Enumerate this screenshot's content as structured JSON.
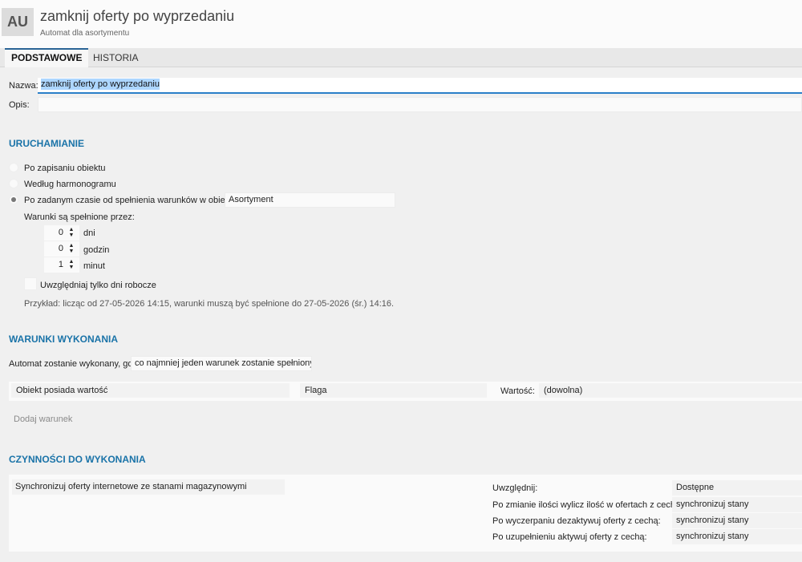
{
  "header": {
    "avatar": "AU",
    "title": "zamknij oferty po wyprzedaniu",
    "subtitle": "Automat dla asortymentu"
  },
  "tabs": [
    {
      "label": "PODSTAWOWE",
      "active": true
    },
    {
      "label": "HISTORIA",
      "active": false
    }
  ],
  "form": {
    "name_label": "Nazwa:",
    "name_value": "zamknij oferty po wyprzedaniu",
    "desc_label": "Opis:",
    "desc_value": ""
  },
  "run": {
    "section_title": "URUCHAMIANIE",
    "options": [
      {
        "label": "Po zapisaniu obiektu",
        "selected": false
      },
      {
        "label": "Według harmonogramu",
        "selected": false
      },
      {
        "label": "Po zadanym czasie od spełnienia warunków w obiekcie",
        "selected": true
      }
    ],
    "object_value": "Asortyment",
    "conditions_label": "Warunki są spełnione przez:",
    "days_value": "0",
    "days_label": "dni",
    "hours_value": "0",
    "hours_label": "godzin",
    "minutes_value": "1",
    "minutes_label": "minut",
    "workdays_label": "Uwzględniaj tylko dni robocze",
    "workdays_checked": false,
    "example": "Przykład: licząc od 27-05-2026 14:15, warunki muszą być spełnione do 27-05-2026 (śr.) 14:16."
  },
  "conditions": {
    "section_title": "WARUNKI WYKONANIA",
    "mode_label": "Automat zostanie wykonany, gdy",
    "mode_value": "co najmniej jeden warunek zostanie spełniony",
    "row": {
      "field": "Obiekt posiada wartość",
      "attribute": "Flaga",
      "value_label": "Wartość:",
      "value": "(dowolna)"
    },
    "add_label": "Dodaj warunek"
  },
  "actions": {
    "section_title": "CZYNNOŚCI DO WYKONANIA",
    "action": "Synchronizuj oferty internetowe ze stanami magazynowymi",
    "props": [
      {
        "label": "Uwzględnij:",
        "value": "Dostępne"
      },
      {
        "label": "Po zmianie ilości wylicz ilość w ofertach z cechą:",
        "value": "synchronizuj stany"
      },
      {
        "label": "Po wyczerpaniu dezaktywuj oferty z cechą:",
        "value": "synchronizuj stany"
      },
      {
        "label": "Po uzupełnieniu aktywuj oferty z cechą:",
        "value": "synchronizuj stany"
      }
    ]
  },
  "colors": {
    "accent": "#1a73a8",
    "selection": "#add6ff",
    "focus_underline": "#2a7fc8"
  }
}
